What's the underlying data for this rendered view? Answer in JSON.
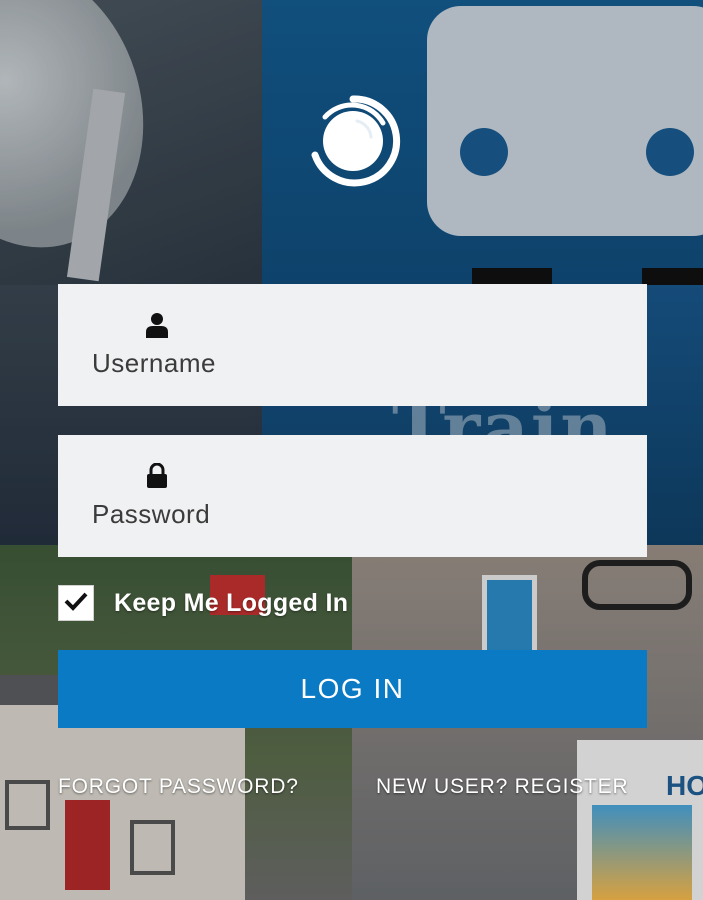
{
  "logo": {
    "icon": "swirl-logo-icon",
    "color": "#ffffff"
  },
  "background": {
    "text": "Train Bo",
    "corner_text": "HO"
  },
  "username_field": {
    "icon": "user-icon",
    "placeholder": "Username",
    "value": ""
  },
  "password_field": {
    "icon": "lock-icon",
    "placeholder": "Password",
    "value": ""
  },
  "remember": {
    "label": "Keep Me Logged In",
    "checked": true,
    "icon": "checkmark-icon"
  },
  "login_button": {
    "label": "LOG IN",
    "color": "#0a7ac4"
  },
  "links": {
    "forgot_password": "FORGOT PASSWORD?",
    "register": "NEW USER? REGISTER"
  }
}
